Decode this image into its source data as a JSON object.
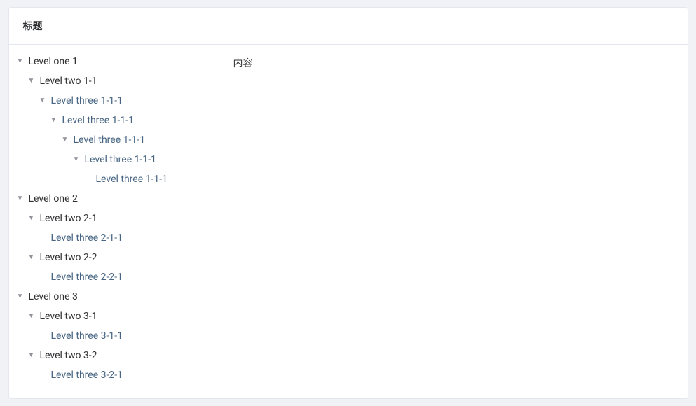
{
  "header": {
    "title": "标题"
  },
  "content": {
    "text": "内容"
  },
  "tree": [
    {
      "id": "l1",
      "label": "Level one 1",
      "level": 1,
      "expanded": true,
      "indent": 8,
      "children": [
        {
          "id": "l1-2-1",
          "label": "Level two 1-1",
          "level": 2,
          "expanded": true,
          "indent": 24,
          "children": [
            {
              "id": "l1-3-1",
              "label": "Level three 1-1-1",
              "level": 3,
              "expanded": true,
              "indent": 40,
              "children": [
                {
                  "id": "l1-3-2",
                  "label": "Level three 1-1-1",
                  "level": 3,
                  "expanded": true,
                  "indent": 56,
                  "children": [
                    {
                      "id": "l1-3-3",
                      "label": "Level three 1-1-1",
                      "level": 3,
                      "expanded": true,
                      "indent": 72,
                      "children": [
                        {
                          "id": "l1-3-4",
                          "label": "Level three 1-1-1",
                          "level": 3,
                          "expanded": true,
                          "indent": 88,
                          "children": [
                            {
                              "id": "l1-3-5",
                              "label": "Level three 1-1-1",
                              "level": 3,
                              "expanded": false,
                              "indent": 108,
                              "children": []
                            }
                          ]
                        }
                      ]
                    }
                  ]
                }
              ]
            }
          ]
        }
      ]
    },
    {
      "id": "l2",
      "label": "Level one 2",
      "level": 1,
      "expanded": true,
      "indent": 8,
      "children": [
        {
          "id": "l2-2-1",
          "label": "Level two 2-1",
          "level": 2,
          "expanded": true,
          "indent": 24,
          "children": [
            {
              "id": "l2-3-1",
              "label": "Level three 2-1-1",
              "level": 3,
              "expanded": false,
              "indent": 44,
              "children": []
            }
          ]
        },
        {
          "id": "l2-2-2",
          "label": "Level two 2-2",
          "level": 2,
          "expanded": true,
          "indent": 24,
          "children": [
            {
              "id": "l2-3-2",
              "label": "Level three 2-2-1",
              "level": 3,
              "expanded": false,
              "indent": 44,
              "children": []
            }
          ]
        }
      ]
    },
    {
      "id": "l3",
      "label": "Level one 3",
      "level": 1,
      "expanded": true,
      "indent": 8,
      "children": [
        {
          "id": "l3-2-1",
          "label": "Level two 3-1",
          "level": 2,
          "expanded": true,
          "indent": 24,
          "children": [
            {
              "id": "l3-3-1",
              "label": "Level three 3-1-1",
              "level": 3,
              "expanded": false,
              "indent": 44,
              "children": []
            }
          ]
        },
        {
          "id": "l3-2-2",
          "label": "Level two 3-2",
          "level": 2,
          "expanded": true,
          "indent": 24,
          "children": [
            {
              "id": "l3-3-2",
              "label": "Level three 3-2-1",
              "level": 3,
              "expanded": false,
              "indent": 44,
              "children": []
            }
          ]
        }
      ]
    }
  ]
}
